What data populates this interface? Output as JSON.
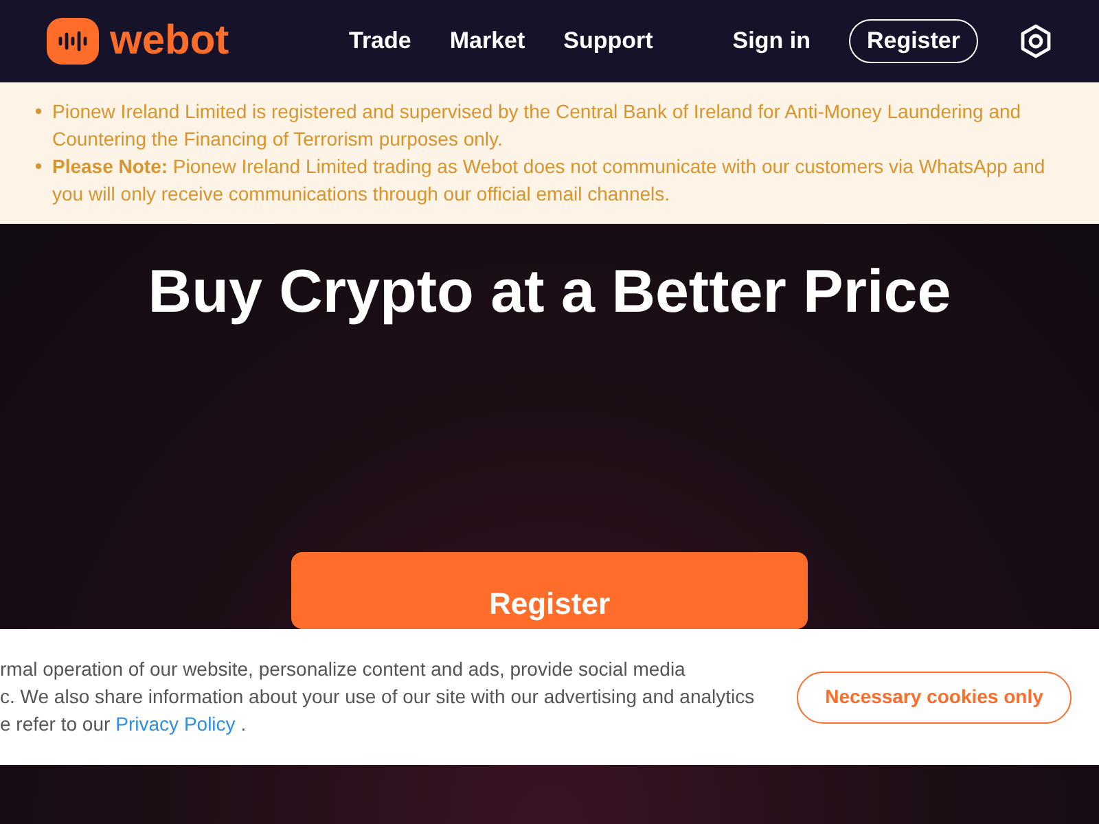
{
  "header": {
    "logo_text": "webot",
    "nav": [
      "Trade",
      "Market",
      "Support"
    ],
    "sign_in": "Sign in",
    "register": "Register"
  },
  "notice": {
    "items": [
      {
        "text": "Pionew Ireland Limited is registered and supervised by the Central Bank of Ireland for Anti-Money Laundering and Countering the Financing of Terrorism purposes only."
      },
      {
        "text": "**Please Note:** Pionew Ireland Limited trading as Webot does not communicate with our customers via WhatsApp and you will only receive communications through our official email channels."
      }
    ]
  },
  "hero": {
    "title": "Buy Crypto at a Better Price",
    "button": "Register"
  },
  "cookie_banner": {
    "lines": [
      "rmal operation of our website, personalize content and ads, provide social media",
      "c. We also share information about your use of our site with our advertising and analytics"
    ],
    "last_line_prefix": "e refer to our",
    "link": "Privacy Policy",
    "last_line_suffix": ".",
    "button": "Necessary cookies only"
  }
}
